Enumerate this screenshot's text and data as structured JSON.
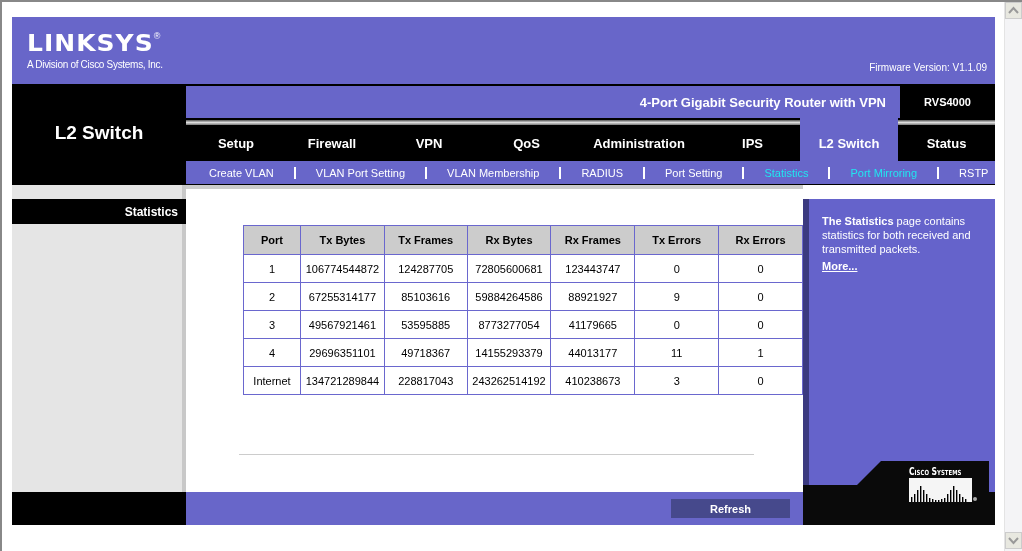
{
  "brand": {
    "logo": "LINKSYS",
    "registered": "®",
    "tagline": "A Division of Cisco Systems, Inc.",
    "firmware": "Firmware Version: V1.1.09"
  },
  "section_title": "L2 Switch",
  "product": {
    "name": "4-Port Gigabit Security Router with VPN",
    "model": "RVS4000"
  },
  "tabs": [
    {
      "label": "Setup",
      "selected": false
    },
    {
      "label": "Firewall",
      "selected": false
    },
    {
      "label": "VPN",
      "selected": false
    },
    {
      "label": "QoS",
      "selected": false
    },
    {
      "label": "Administration",
      "selected": false
    },
    {
      "label": "IPS",
      "selected": false
    },
    {
      "label": "L2 Switch",
      "selected": true
    },
    {
      "label": "Status",
      "selected": false
    }
  ],
  "subtabs": [
    {
      "label": "Create VLAN",
      "highlighted": false
    },
    {
      "label": "VLAN Port Setting",
      "highlighted": false
    },
    {
      "label": "VLAN Membership",
      "highlighted": false
    },
    {
      "label": "RADIUS",
      "highlighted": false
    },
    {
      "label": "Port Setting",
      "highlighted": false
    },
    {
      "label": "Statistics",
      "highlighted": true
    },
    {
      "label": "Port Mirroring",
      "highlighted": true
    },
    {
      "label": "RSTP",
      "highlighted": false
    }
  ],
  "sidebar": {
    "heading": "Statistics"
  },
  "table": {
    "columns": [
      "Port",
      "Tx Bytes",
      "Tx Frames",
      "Rx Bytes",
      "Rx Frames",
      "Tx Errors",
      "Rx Errors"
    ],
    "rows": [
      [
        "1",
        "106774544872",
        "124287705",
        "72805600681",
        "123443747",
        "0",
        "0"
      ],
      [
        "2",
        "67255314177",
        "85103616",
        "59884264586",
        "88921927",
        "9",
        "0"
      ],
      [
        "3",
        "49567921461",
        "53595885",
        "8773277054",
        "41179665",
        "0",
        "0"
      ],
      [
        "4",
        "29696351101",
        "49718367",
        "14155293379",
        "44013177",
        "11",
        "1"
      ],
      [
        "Internet",
        "134721289844",
        "228817043",
        "243262514192",
        "410238673",
        "3",
        "0"
      ]
    ]
  },
  "help": {
    "text": "**The Statistics** page contains statistics for both received and transmitted packets.",
    "link": "More..."
  },
  "cisco_logo": "Cisco Systems",
  "buttons": {
    "refresh": "Refresh"
  }
}
